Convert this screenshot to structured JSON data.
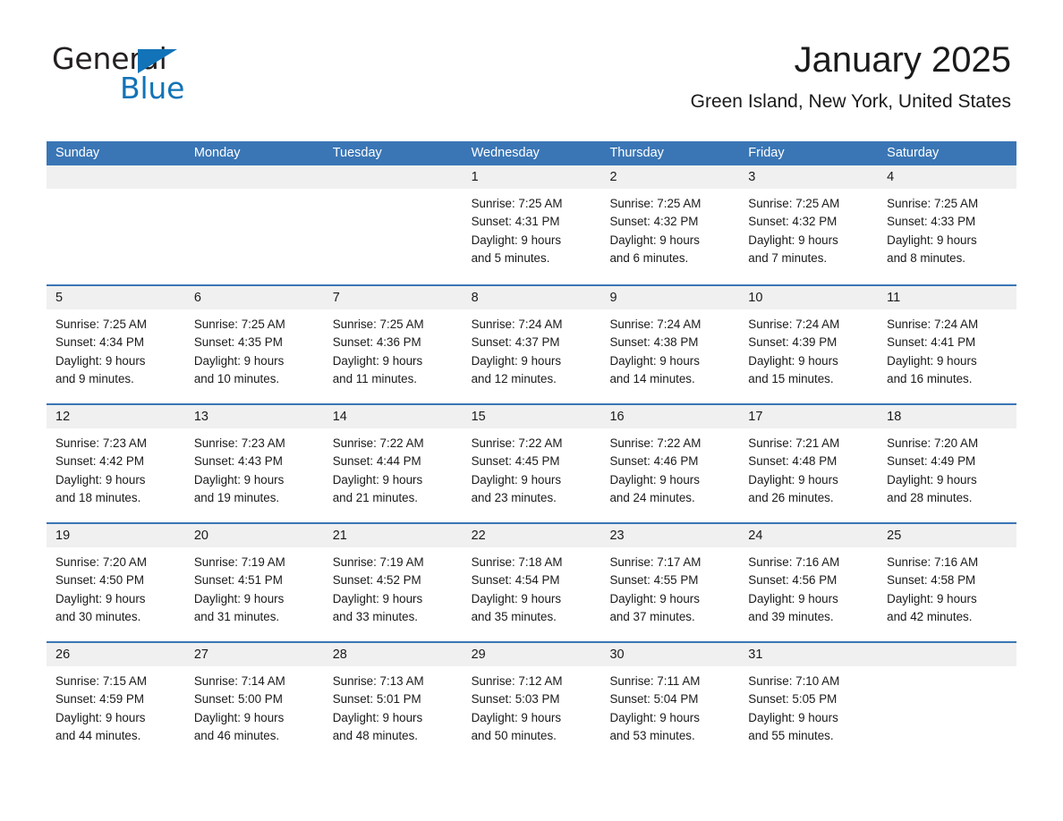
{
  "brand": {
    "name_part1": "General",
    "name_part2": "Blue",
    "triangle_color": "#1273b8"
  },
  "header": {
    "title": "January 2025",
    "subtitle": "Green Island, New York, United States",
    "accent_color": "#3a76b5",
    "band_color": "#f0f0f0"
  },
  "weekdays": [
    "Sunday",
    "Monday",
    "Tuesday",
    "Wednesday",
    "Thursday",
    "Friday",
    "Saturday"
  ],
  "weeks": [
    [
      {
        "day": "",
        "sunrise": "",
        "sunset": "",
        "daylight1": "",
        "daylight2": ""
      },
      {
        "day": "",
        "sunrise": "",
        "sunset": "",
        "daylight1": "",
        "daylight2": ""
      },
      {
        "day": "",
        "sunrise": "",
        "sunset": "",
        "daylight1": "",
        "daylight2": ""
      },
      {
        "day": "1",
        "sunrise": "Sunrise: 7:25 AM",
        "sunset": "Sunset: 4:31 PM",
        "daylight1": "Daylight: 9 hours",
        "daylight2": "and 5 minutes."
      },
      {
        "day": "2",
        "sunrise": "Sunrise: 7:25 AM",
        "sunset": "Sunset: 4:32 PM",
        "daylight1": "Daylight: 9 hours",
        "daylight2": "and 6 minutes."
      },
      {
        "day": "3",
        "sunrise": "Sunrise: 7:25 AM",
        "sunset": "Sunset: 4:32 PM",
        "daylight1": "Daylight: 9 hours",
        "daylight2": "and 7 minutes."
      },
      {
        "day": "4",
        "sunrise": "Sunrise: 7:25 AM",
        "sunset": "Sunset: 4:33 PM",
        "daylight1": "Daylight: 9 hours",
        "daylight2": "and 8 minutes."
      }
    ],
    [
      {
        "day": "5",
        "sunrise": "Sunrise: 7:25 AM",
        "sunset": "Sunset: 4:34 PM",
        "daylight1": "Daylight: 9 hours",
        "daylight2": "and 9 minutes."
      },
      {
        "day": "6",
        "sunrise": "Sunrise: 7:25 AM",
        "sunset": "Sunset: 4:35 PM",
        "daylight1": "Daylight: 9 hours",
        "daylight2": "and 10 minutes."
      },
      {
        "day": "7",
        "sunrise": "Sunrise: 7:25 AM",
        "sunset": "Sunset: 4:36 PM",
        "daylight1": "Daylight: 9 hours",
        "daylight2": "and 11 minutes."
      },
      {
        "day": "8",
        "sunrise": "Sunrise: 7:24 AM",
        "sunset": "Sunset: 4:37 PM",
        "daylight1": "Daylight: 9 hours",
        "daylight2": "and 12 minutes."
      },
      {
        "day": "9",
        "sunrise": "Sunrise: 7:24 AM",
        "sunset": "Sunset: 4:38 PM",
        "daylight1": "Daylight: 9 hours",
        "daylight2": "and 14 minutes."
      },
      {
        "day": "10",
        "sunrise": "Sunrise: 7:24 AM",
        "sunset": "Sunset: 4:39 PM",
        "daylight1": "Daylight: 9 hours",
        "daylight2": "and 15 minutes."
      },
      {
        "day": "11",
        "sunrise": "Sunrise: 7:24 AM",
        "sunset": "Sunset: 4:41 PM",
        "daylight1": "Daylight: 9 hours",
        "daylight2": "and 16 minutes."
      }
    ],
    [
      {
        "day": "12",
        "sunrise": "Sunrise: 7:23 AM",
        "sunset": "Sunset: 4:42 PM",
        "daylight1": "Daylight: 9 hours",
        "daylight2": "and 18 minutes."
      },
      {
        "day": "13",
        "sunrise": "Sunrise: 7:23 AM",
        "sunset": "Sunset: 4:43 PM",
        "daylight1": "Daylight: 9 hours",
        "daylight2": "and 19 minutes."
      },
      {
        "day": "14",
        "sunrise": "Sunrise: 7:22 AM",
        "sunset": "Sunset: 4:44 PM",
        "daylight1": "Daylight: 9 hours",
        "daylight2": "and 21 minutes."
      },
      {
        "day": "15",
        "sunrise": "Sunrise: 7:22 AM",
        "sunset": "Sunset: 4:45 PM",
        "daylight1": "Daylight: 9 hours",
        "daylight2": "and 23 minutes."
      },
      {
        "day": "16",
        "sunrise": "Sunrise: 7:22 AM",
        "sunset": "Sunset: 4:46 PM",
        "daylight1": "Daylight: 9 hours",
        "daylight2": "and 24 minutes."
      },
      {
        "day": "17",
        "sunrise": "Sunrise: 7:21 AM",
        "sunset": "Sunset: 4:48 PM",
        "daylight1": "Daylight: 9 hours",
        "daylight2": "and 26 minutes."
      },
      {
        "day": "18",
        "sunrise": "Sunrise: 7:20 AM",
        "sunset": "Sunset: 4:49 PM",
        "daylight1": "Daylight: 9 hours",
        "daylight2": "and 28 minutes."
      }
    ],
    [
      {
        "day": "19",
        "sunrise": "Sunrise: 7:20 AM",
        "sunset": "Sunset: 4:50 PM",
        "daylight1": "Daylight: 9 hours",
        "daylight2": "and 30 minutes."
      },
      {
        "day": "20",
        "sunrise": "Sunrise: 7:19 AM",
        "sunset": "Sunset: 4:51 PM",
        "daylight1": "Daylight: 9 hours",
        "daylight2": "and 31 minutes."
      },
      {
        "day": "21",
        "sunrise": "Sunrise: 7:19 AM",
        "sunset": "Sunset: 4:52 PM",
        "daylight1": "Daylight: 9 hours",
        "daylight2": "and 33 minutes."
      },
      {
        "day": "22",
        "sunrise": "Sunrise: 7:18 AM",
        "sunset": "Sunset: 4:54 PM",
        "daylight1": "Daylight: 9 hours",
        "daylight2": "and 35 minutes."
      },
      {
        "day": "23",
        "sunrise": "Sunrise: 7:17 AM",
        "sunset": "Sunset: 4:55 PM",
        "daylight1": "Daylight: 9 hours",
        "daylight2": "and 37 minutes."
      },
      {
        "day": "24",
        "sunrise": "Sunrise: 7:16 AM",
        "sunset": "Sunset: 4:56 PM",
        "daylight1": "Daylight: 9 hours",
        "daylight2": "and 39 minutes."
      },
      {
        "day": "25",
        "sunrise": "Sunrise: 7:16 AM",
        "sunset": "Sunset: 4:58 PM",
        "daylight1": "Daylight: 9 hours",
        "daylight2": "and 42 minutes."
      }
    ],
    [
      {
        "day": "26",
        "sunrise": "Sunrise: 7:15 AM",
        "sunset": "Sunset: 4:59 PM",
        "daylight1": "Daylight: 9 hours",
        "daylight2": "and 44 minutes."
      },
      {
        "day": "27",
        "sunrise": "Sunrise: 7:14 AM",
        "sunset": "Sunset: 5:00 PM",
        "daylight1": "Daylight: 9 hours",
        "daylight2": "and 46 minutes."
      },
      {
        "day": "28",
        "sunrise": "Sunrise: 7:13 AM",
        "sunset": "Sunset: 5:01 PM",
        "daylight1": "Daylight: 9 hours",
        "daylight2": "and 48 minutes."
      },
      {
        "day": "29",
        "sunrise": "Sunrise: 7:12 AM",
        "sunset": "Sunset: 5:03 PM",
        "daylight1": "Daylight: 9 hours",
        "daylight2": "and 50 minutes."
      },
      {
        "day": "30",
        "sunrise": "Sunrise: 7:11 AM",
        "sunset": "Sunset: 5:04 PM",
        "daylight1": "Daylight: 9 hours",
        "daylight2": "and 53 minutes."
      },
      {
        "day": "31",
        "sunrise": "Sunrise: 7:10 AM",
        "sunset": "Sunset: 5:05 PM",
        "daylight1": "Daylight: 9 hours",
        "daylight2": "and 55 minutes."
      },
      {
        "day": "",
        "sunrise": "",
        "sunset": "",
        "daylight1": "",
        "daylight2": ""
      }
    ]
  ]
}
